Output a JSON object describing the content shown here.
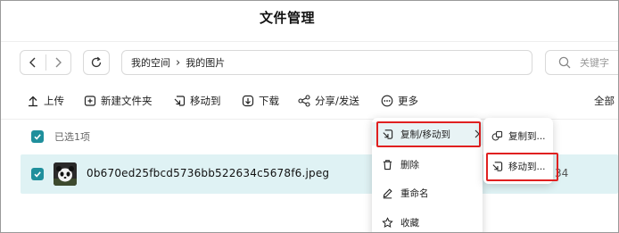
{
  "page": {
    "title": "文件管理"
  },
  "nav": {
    "back_icon": "chevron-left-icon",
    "forward_icon": "chevron-right-icon",
    "refresh_icon": "refresh-icon",
    "breadcrumb": [
      "我的空间",
      "我的图片"
    ],
    "breadcrumb_sep": "›"
  },
  "search": {
    "placeholder": "关键字"
  },
  "toolbar": {
    "upload": "上传",
    "new_folder": "新建文件夹",
    "move_to": "移动到",
    "download": "下载",
    "share": "分享/发送",
    "more": "更多",
    "all": "全部"
  },
  "selection": {
    "label": "已选1项"
  },
  "file": {
    "name": "0b670ed25fbcd5736bb522634c5678f6.jpeg",
    "size_fragment": "34"
  },
  "context_menu": {
    "items": [
      {
        "label": "复制/移动到",
        "icon": "move-icon"
      },
      {
        "label": "删除",
        "icon": "trash-icon"
      },
      {
        "label": "重命名",
        "icon": "pen-icon"
      },
      {
        "label": "收藏",
        "icon": "star-icon"
      }
    ],
    "submenu": [
      {
        "label": "复制到...",
        "icon": "copy-icon"
      },
      {
        "label": "移动到...",
        "icon": "move-icon"
      }
    ]
  },
  "colors": {
    "accent": "#1f8f9c",
    "highlight": "#e02020",
    "row_selected": "#dff2f4"
  }
}
